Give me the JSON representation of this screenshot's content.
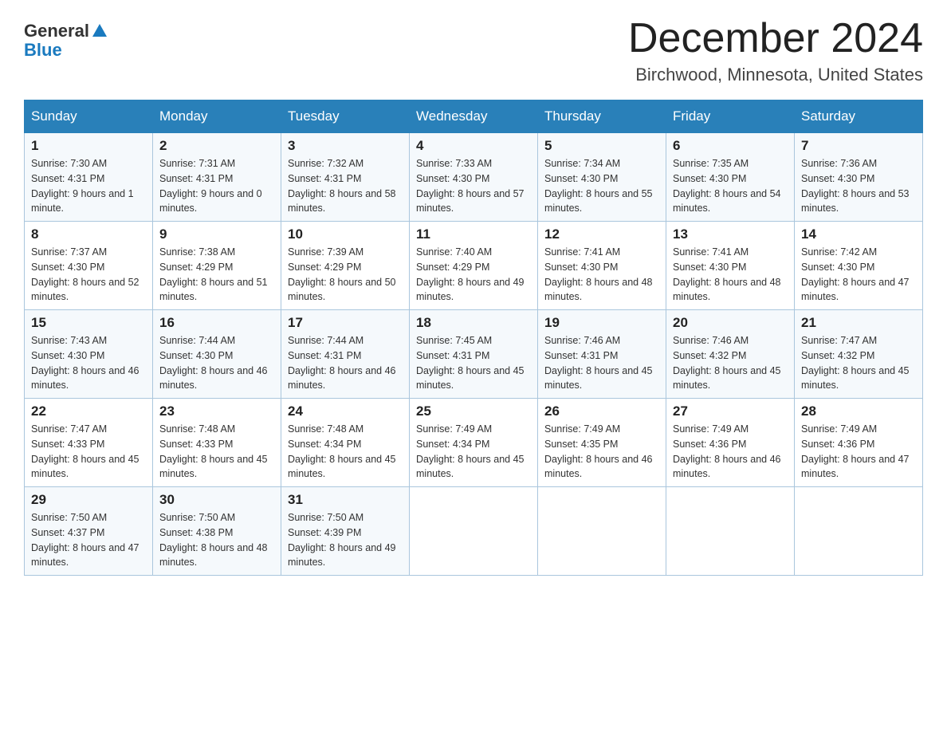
{
  "header": {
    "logo_line1": "General",
    "logo_line2": "Blue",
    "month": "December 2024",
    "location": "Birchwood, Minnesota, United States"
  },
  "days_of_week": [
    "Sunday",
    "Monday",
    "Tuesday",
    "Wednesday",
    "Thursday",
    "Friday",
    "Saturday"
  ],
  "weeks": [
    [
      {
        "day": "1",
        "sunrise": "7:30 AM",
        "sunset": "4:31 PM",
        "daylight": "9 hours and 1 minute."
      },
      {
        "day": "2",
        "sunrise": "7:31 AM",
        "sunset": "4:31 PM",
        "daylight": "9 hours and 0 minutes."
      },
      {
        "day": "3",
        "sunrise": "7:32 AM",
        "sunset": "4:31 PM",
        "daylight": "8 hours and 58 minutes."
      },
      {
        "day": "4",
        "sunrise": "7:33 AM",
        "sunset": "4:30 PM",
        "daylight": "8 hours and 57 minutes."
      },
      {
        "day": "5",
        "sunrise": "7:34 AM",
        "sunset": "4:30 PM",
        "daylight": "8 hours and 55 minutes."
      },
      {
        "day": "6",
        "sunrise": "7:35 AM",
        "sunset": "4:30 PM",
        "daylight": "8 hours and 54 minutes."
      },
      {
        "day": "7",
        "sunrise": "7:36 AM",
        "sunset": "4:30 PM",
        "daylight": "8 hours and 53 minutes."
      }
    ],
    [
      {
        "day": "8",
        "sunrise": "7:37 AM",
        "sunset": "4:30 PM",
        "daylight": "8 hours and 52 minutes."
      },
      {
        "day": "9",
        "sunrise": "7:38 AM",
        "sunset": "4:29 PM",
        "daylight": "8 hours and 51 minutes."
      },
      {
        "day": "10",
        "sunrise": "7:39 AM",
        "sunset": "4:29 PM",
        "daylight": "8 hours and 50 minutes."
      },
      {
        "day": "11",
        "sunrise": "7:40 AM",
        "sunset": "4:29 PM",
        "daylight": "8 hours and 49 minutes."
      },
      {
        "day": "12",
        "sunrise": "7:41 AM",
        "sunset": "4:30 PM",
        "daylight": "8 hours and 48 minutes."
      },
      {
        "day": "13",
        "sunrise": "7:41 AM",
        "sunset": "4:30 PM",
        "daylight": "8 hours and 48 minutes."
      },
      {
        "day": "14",
        "sunrise": "7:42 AM",
        "sunset": "4:30 PM",
        "daylight": "8 hours and 47 minutes."
      }
    ],
    [
      {
        "day": "15",
        "sunrise": "7:43 AM",
        "sunset": "4:30 PM",
        "daylight": "8 hours and 46 minutes."
      },
      {
        "day": "16",
        "sunrise": "7:44 AM",
        "sunset": "4:30 PM",
        "daylight": "8 hours and 46 minutes."
      },
      {
        "day": "17",
        "sunrise": "7:44 AM",
        "sunset": "4:31 PM",
        "daylight": "8 hours and 46 minutes."
      },
      {
        "day": "18",
        "sunrise": "7:45 AM",
        "sunset": "4:31 PM",
        "daylight": "8 hours and 45 minutes."
      },
      {
        "day": "19",
        "sunrise": "7:46 AM",
        "sunset": "4:31 PM",
        "daylight": "8 hours and 45 minutes."
      },
      {
        "day": "20",
        "sunrise": "7:46 AM",
        "sunset": "4:32 PM",
        "daylight": "8 hours and 45 minutes."
      },
      {
        "day": "21",
        "sunrise": "7:47 AM",
        "sunset": "4:32 PM",
        "daylight": "8 hours and 45 minutes."
      }
    ],
    [
      {
        "day": "22",
        "sunrise": "7:47 AM",
        "sunset": "4:33 PM",
        "daylight": "8 hours and 45 minutes."
      },
      {
        "day": "23",
        "sunrise": "7:48 AM",
        "sunset": "4:33 PM",
        "daylight": "8 hours and 45 minutes."
      },
      {
        "day": "24",
        "sunrise": "7:48 AM",
        "sunset": "4:34 PM",
        "daylight": "8 hours and 45 minutes."
      },
      {
        "day": "25",
        "sunrise": "7:49 AM",
        "sunset": "4:34 PM",
        "daylight": "8 hours and 45 minutes."
      },
      {
        "day": "26",
        "sunrise": "7:49 AM",
        "sunset": "4:35 PM",
        "daylight": "8 hours and 46 minutes."
      },
      {
        "day": "27",
        "sunrise": "7:49 AM",
        "sunset": "4:36 PM",
        "daylight": "8 hours and 46 minutes."
      },
      {
        "day": "28",
        "sunrise": "7:49 AM",
        "sunset": "4:36 PM",
        "daylight": "8 hours and 47 minutes."
      }
    ],
    [
      {
        "day": "29",
        "sunrise": "7:50 AM",
        "sunset": "4:37 PM",
        "daylight": "8 hours and 47 minutes."
      },
      {
        "day": "30",
        "sunrise": "7:50 AM",
        "sunset": "4:38 PM",
        "daylight": "8 hours and 48 minutes."
      },
      {
        "day": "31",
        "sunrise": "7:50 AM",
        "sunset": "4:39 PM",
        "daylight": "8 hours and 49 minutes."
      },
      null,
      null,
      null,
      null
    ]
  ]
}
